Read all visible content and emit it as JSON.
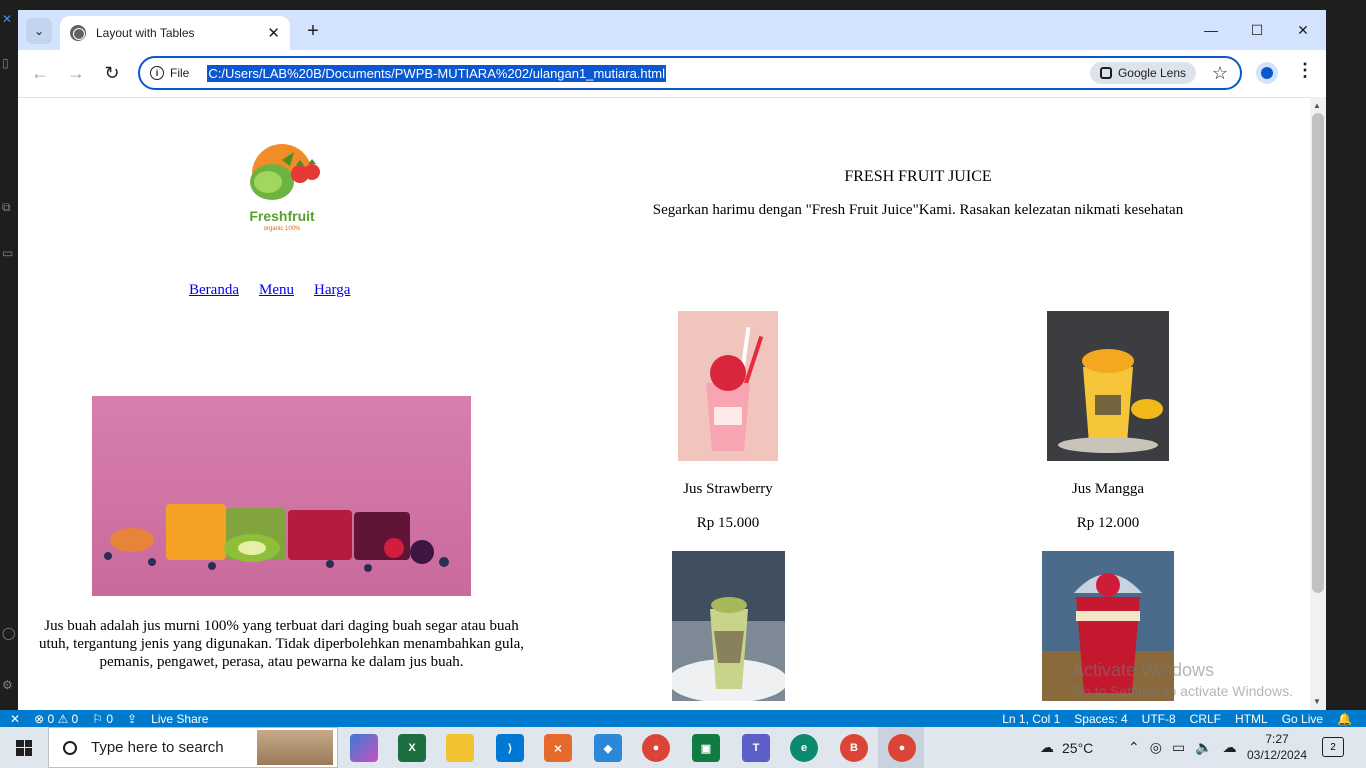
{
  "browser": {
    "tab_title": "Layout with Tables",
    "tab_close": "✕",
    "new_tab": "+",
    "minimize": "—",
    "maximize": "☐",
    "close": "✕",
    "back": "←",
    "forward": "→",
    "reload": "↻",
    "file_label": "File",
    "url": "C:/Users/LAB%20B/Documents/PWPB-MUTIARA%202/ulangan1_mutiara.html",
    "lens_label": "Google Lens",
    "star": "☆",
    "menu": "⋮"
  },
  "page": {
    "logo_text": "Freshfruit",
    "logo_sub": "organic 100%",
    "title": "FRESH FRUIT JUICE",
    "tagline": "Segarkan harimu dengan \"Fresh Fruit Juice\"Kami. Rasakan kelezatan nikmati kesehatan",
    "nav": [
      "Beranda",
      "Menu",
      "Harga"
    ],
    "about": "Jus buah adalah jus murni 100% yang terbuat dari daging buah segar atau buah utuh, tergantung jenis yang digunakan. Tidak diperbolehkan menambahkan gula, pemanis, pengawet, perasa, atau pewarna ke dalam jus buah.",
    "products": [
      {
        "name": "Jus Strawberry",
        "price": "Rp 15.000"
      },
      {
        "name": "Jus Mangga",
        "price": "Rp 12.000"
      }
    ]
  },
  "watermark": {
    "line1": "Activate Windows",
    "line2": "Go to Settings to activate Windows."
  },
  "statusbar": {
    "errors": "⊗ 0 ⚠ 0",
    "ports": "⚐ 0",
    "live_share": "Live Share",
    "position": "Ln 1, Col 1",
    "spaces": "Spaces: 4",
    "encoding": "UTF-8",
    "eol": "CRLF",
    "language": "HTML",
    "go_live": "Go Live"
  },
  "taskbar": {
    "search_placeholder": "Type here to search",
    "temperature": "25°C",
    "time": "7:27",
    "date": "03/12/2024",
    "notifications": "2"
  },
  "colors": {
    "chrome_tabstrip": "#d3e3fd",
    "accent": "#0b57d0",
    "vscode_status": "#007acc",
    "link": "#0000ee"
  }
}
